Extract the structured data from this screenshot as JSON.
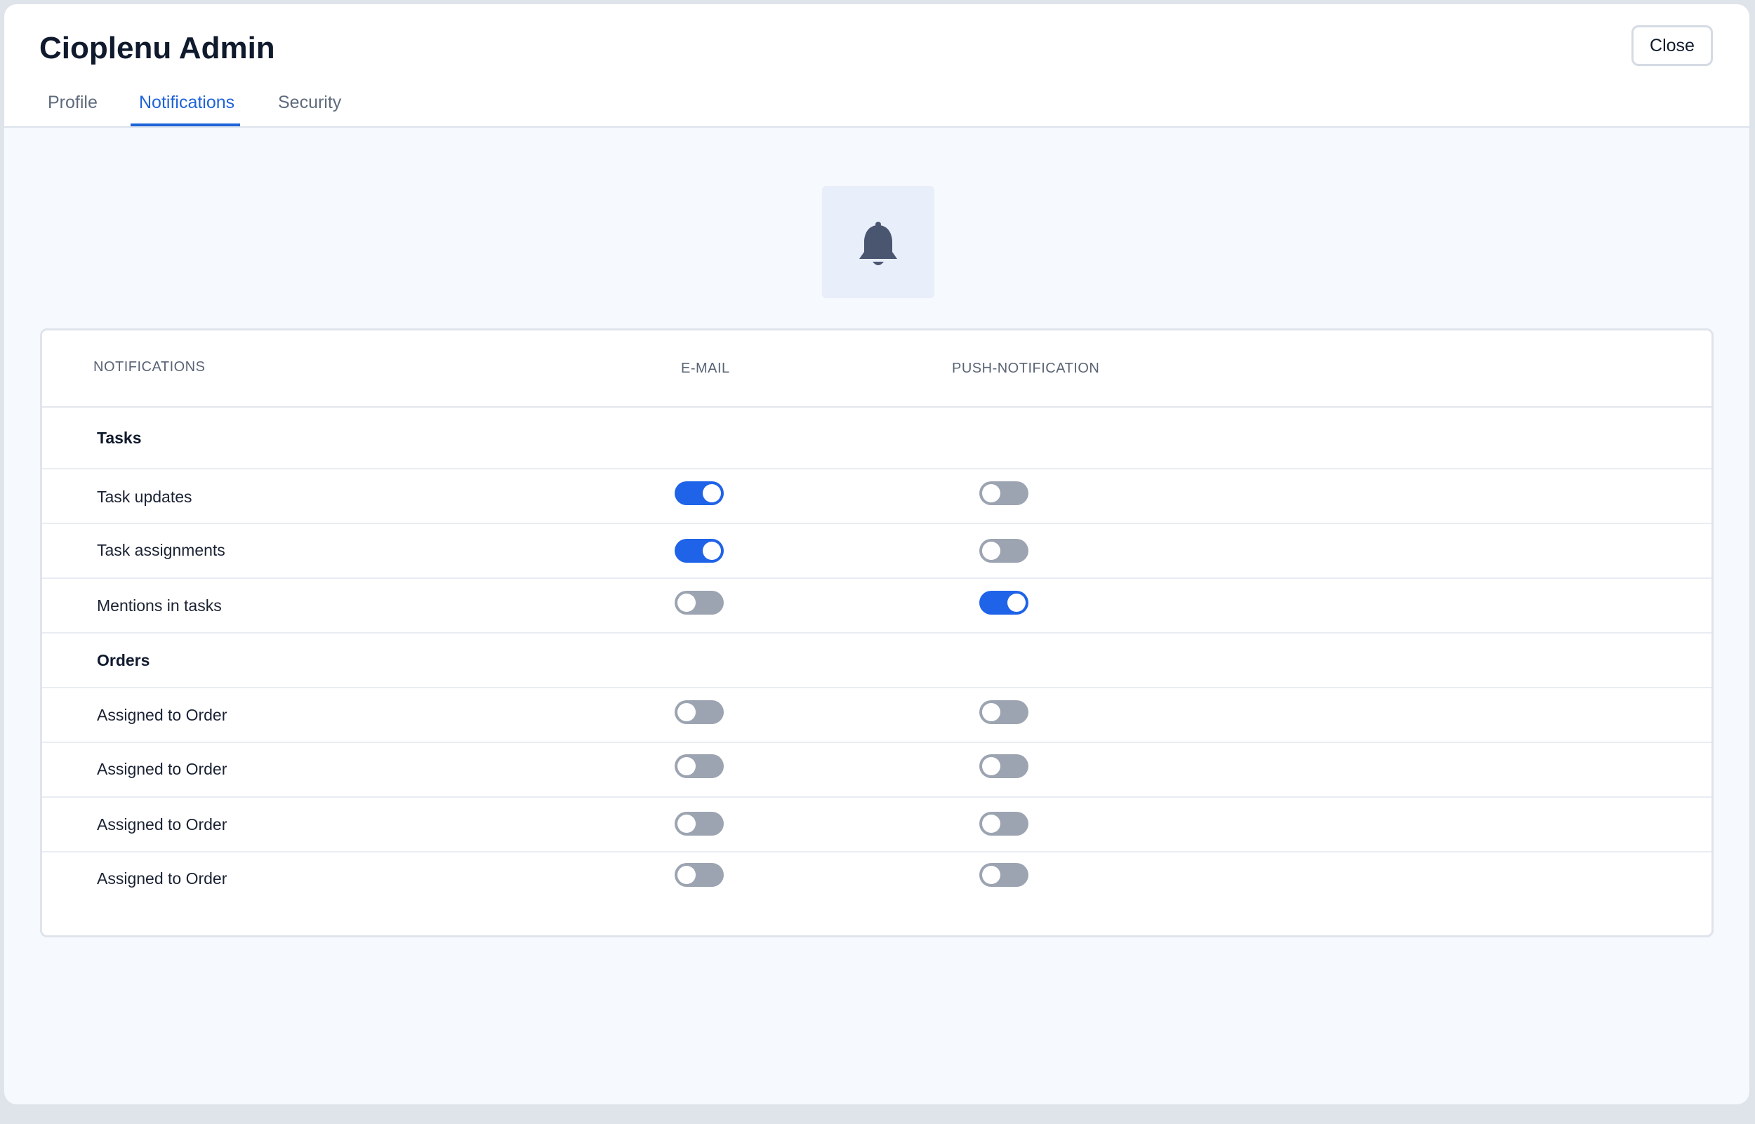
{
  "app": {
    "title": "Cioplenu Admin",
    "close_label": "Close"
  },
  "tabs": [
    {
      "label": "Profile",
      "active": false
    },
    {
      "label": "Notifications",
      "active": true
    },
    {
      "label": "Security",
      "active": false
    }
  ],
  "hero_icon": "bell-icon",
  "table": {
    "headers": {
      "notifications": "NOTIFICATIONS",
      "email": "E-MAIL",
      "push": "PUSH-NOTIFICATION"
    },
    "sections": [
      {
        "title": "Tasks",
        "items": [
          {
            "label": "Task updates",
            "email": true,
            "push": false
          },
          {
            "label": "Task assignments",
            "email": true,
            "push": false
          },
          {
            "label": "Mentions in tasks",
            "email": false,
            "push": true
          }
        ]
      },
      {
        "title": "Orders",
        "items": [
          {
            "label": "Assigned to Order",
            "email": false,
            "push": false
          },
          {
            "label": "Assigned to Order",
            "email": false,
            "push": false
          },
          {
            "label": "Assigned to Order",
            "email": false,
            "push": false
          },
          {
            "label": "Assigned to Order",
            "email": false,
            "push": false
          }
        ]
      }
    ]
  },
  "colors": {
    "accent": "#1f63e8",
    "toggle_off": "#9da4b1",
    "tab_active": "#1f63d8"
  }
}
